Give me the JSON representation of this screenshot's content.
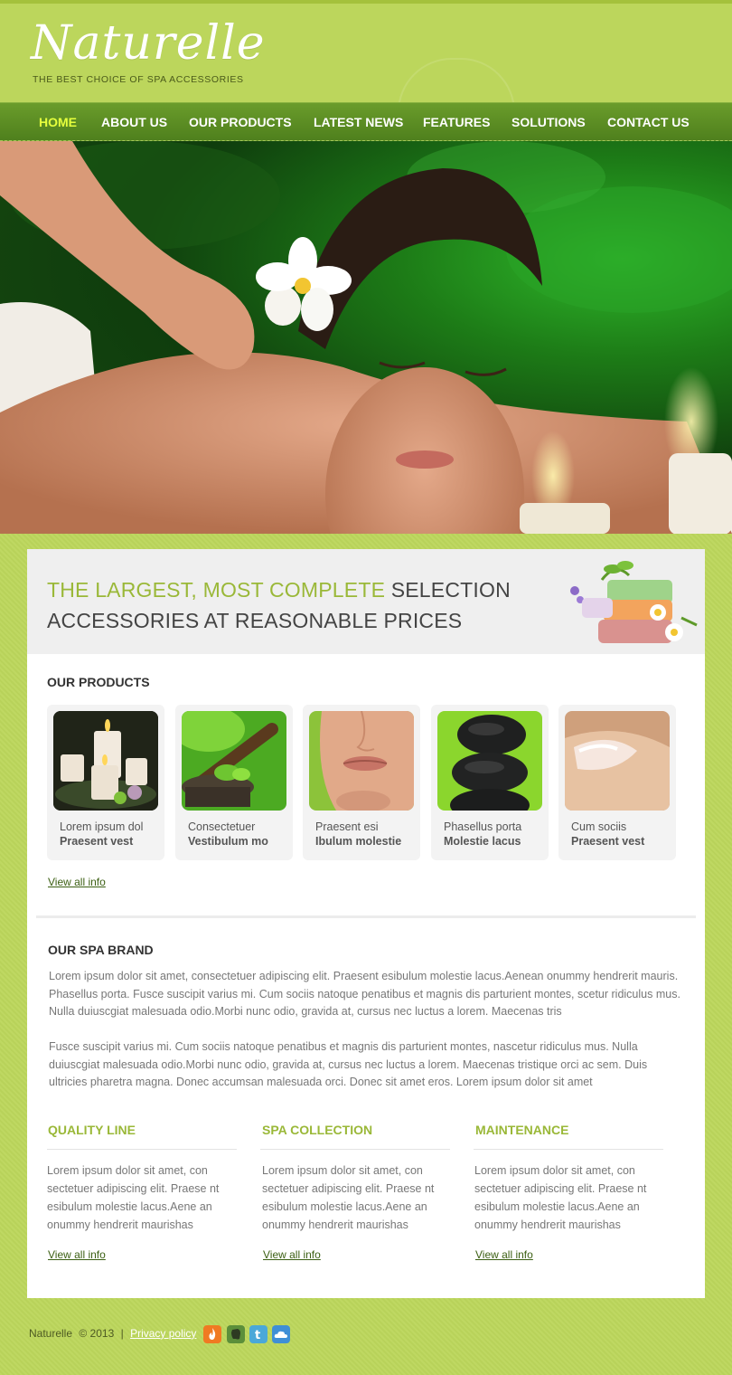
{
  "header": {
    "logo": "Naturelle",
    "tagline": "THE BEST CHOICE OF SPA ACCESSORIES"
  },
  "nav": {
    "items": [
      {
        "label": "HOME",
        "active": true
      },
      {
        "label": "ABOUT US"
      },
      {
        "label": "OUR PRODUCTS"
      },
      {
        "label": "LATEST NEWS"
      },
      {
        "label": "FEATURES"
      },
      {
        "label": "SOLUTIONS"
      },
      {
        "label": "CONTACT US"
      }
    ]
  },
  "banner": {
    "line1_highlight": "THE LARGEST, MOST COMPLETE",
    "line1_rest": "SELECTION",
    "line2": "ACCESSORIES AT REASONABLE PRICES"
  },
  "products": {
    "title": "OUR PRODUCTS",
    "items": [
      {
        "line1": "Lorem ipsum dol",
        "line2": "Praesent vest"
      },
      {
        "line1": "Consectetuer",
        "line2": "Vestibulum mo"
      },
      {
        "line1": "Praesent esi",
        "line2": "Ibulum molestie"
      },
      {
        "line1": "Phasellus porta",
        "line2": "Molestie lacus"
      },
      {
        "line1": "Cum sociis",
        "line2": "Praesent vest"
      }
    ],
    "view_all": "View all info"
  },
  "brand": {
    "title": "OUR SPA BRAND",
    "para1": "Lorem ipsum dolor sit amet, consectetuer adipiscing elit. Praesent esibulum molestie lacus.Aenean onummy hendrerit mauris. Phasellus porta. Fusce suscipit varius mi. Cum sociis natoque penatibus et magnis dis parturient montes, scetur ridiculus mus. Nulla duiuscgiat malesuada odio.Morbi nunc odio, gravida at, cursus nec luctus a lorem. Maecenas tris",
    "para2": "Fusce suscipit varius mi. Cum sociis natoque penatibus et magnis dis parturient montes, nascetur ridiculus mus. Nulla duiuscgiat malesuada odio.Morbi nunc odio, gravida at, cursus nec luctus a lorem. Maecenas tristique orci ac sem. Duis ultricies pharetra magna. Donec accumsan malesuada orci. Donec sit amet eros. Lorem ipsum dolor sit amet"
  },
  "columns": [
    {
      "title": "QUALITY LINE",
      "text": "Lorem ipsum dolor sit amet, con sectetuer adipiscing elit. Praese nt esibulum molestie lacus.Aene an onummy hendrerit maurishas",
      "link": "View all info"
    },
    {
      "title": "SPA COLLECTION",
      "text": "Lorem ipsum dolor sit amet, con sectetuer adipiscing elit. Praese nt esibulum molestie lacus.Aene an onummy hendrerit maurishas",
      "link": "View all info"
    },
    {
      "title": "MAINTENANCE",
      "text": "Lorem ipsum dolor sit amet, con sectetuer adipiscing elit. Praese nt esibulum molestie lacus.Aene an onummy hendrerit maurishas",
      "link": "View all info"
    }
  ],
  "footer": {
    "brand": "Naturelle",
    "copyright": "©  2013",
    "separator": "|",
    "privacy": "Privacy policy",
    "social_icons": [
      "fire-icon",
      "evernote-icon",
      "twitter-icon",
      "cloud-icon"
    ]
  },
  "colors": {
    "background": "#bcd65c",
    "nav": "#5a8c24",
    "nav_active": "#e6ff3d",
    "accent": "#9ab838",
    "link": "#3b5f12"
  }
}
